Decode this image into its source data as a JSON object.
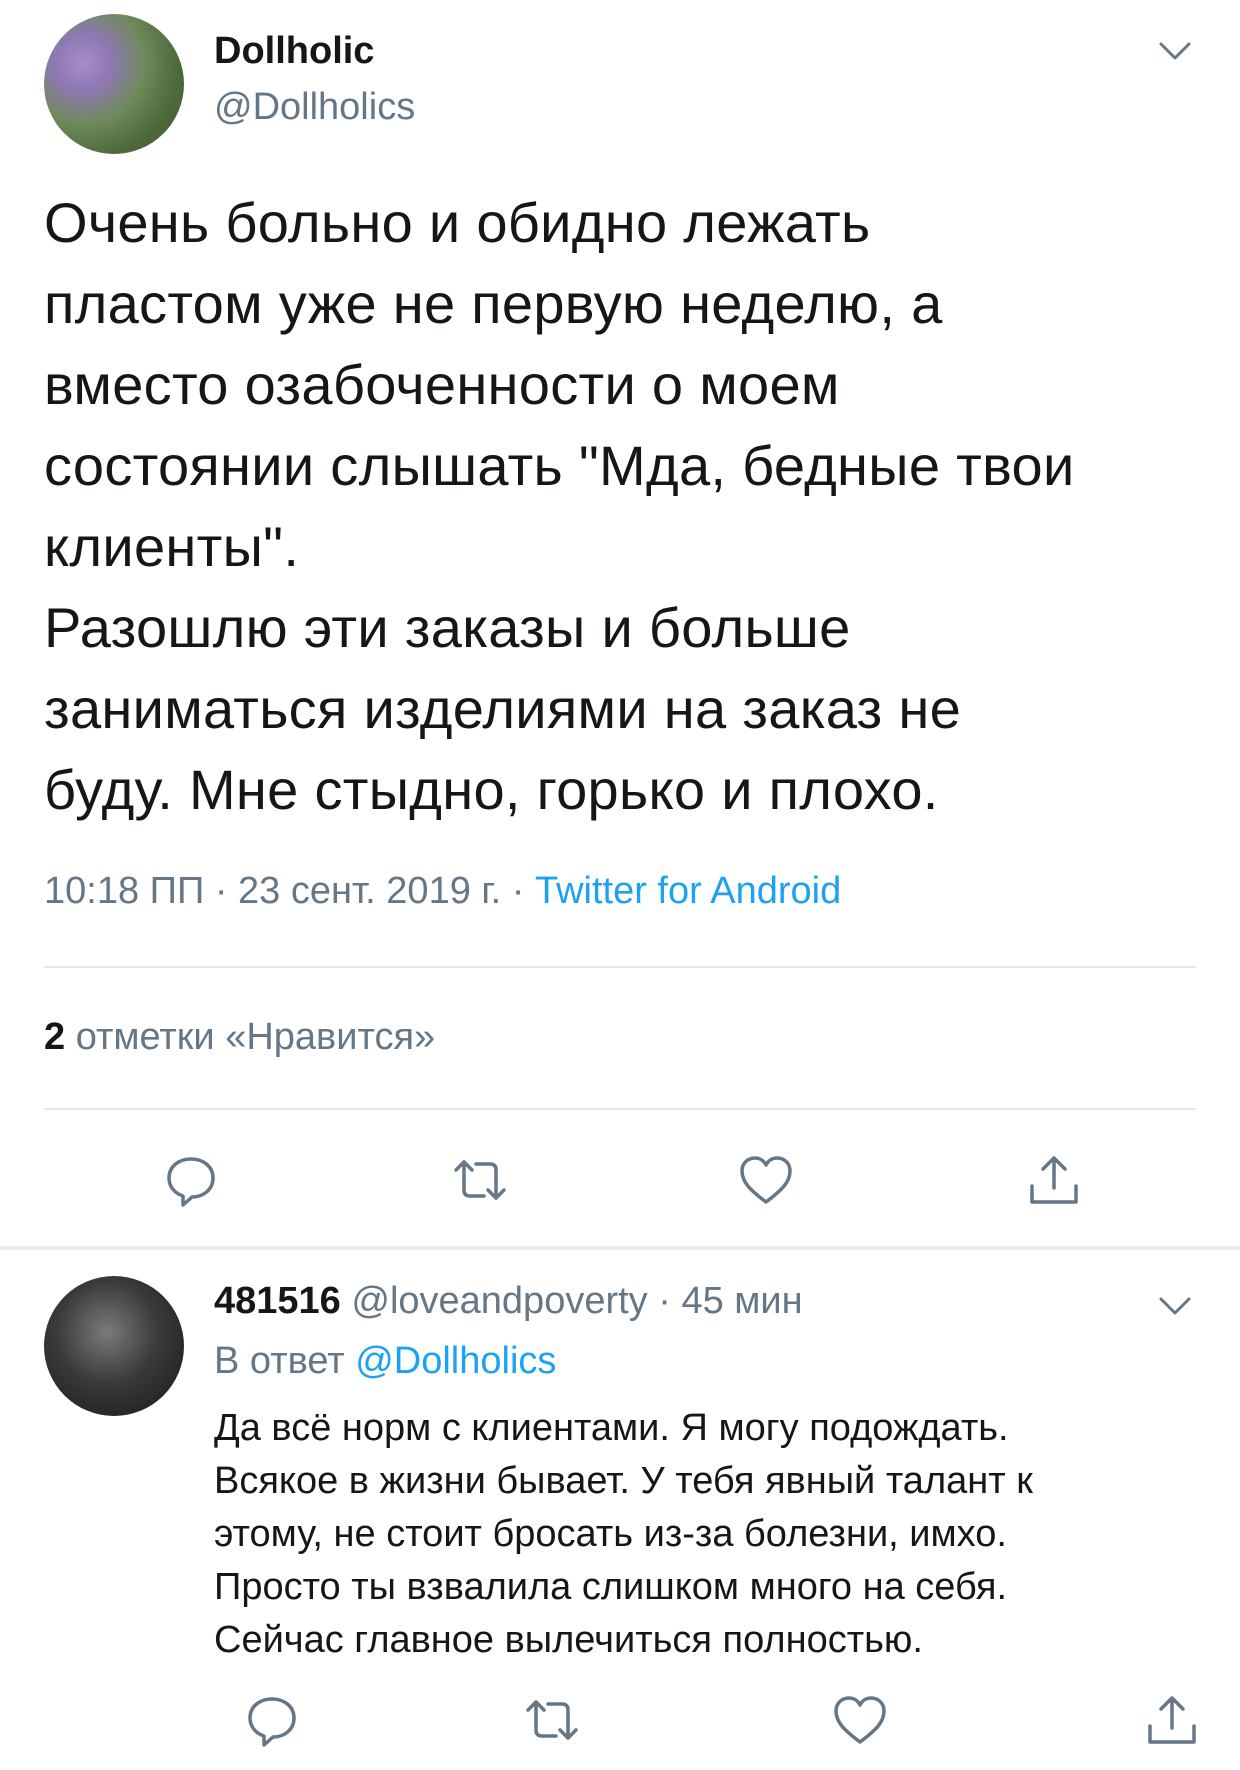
{
  "tweet": {
    "display_name": "Dollholic",
    "handle": "@Dollholics",
    "text": "Очень больно и обидно лежать\nпластом уже не первую неделю, а\nвместо озабоченности о моем\nсостоянии слышать \"Мда, бедные твои\nклиенты\".\nРазошлю эти заказы и больше\nзаниматься изделиями на заказ не\nбуду. Мне стыдно, горько и плохо.",
    "time": "10:18 ПП · 23 сент. 2019 г. · ",
    "source": "Twitter for Android",
    "likes_count": "2",
    "likes_label": " отметки «Нравится»"
  },
  "reply": {
    "display_name": "481516",
    "handle": "@loveandpoverty",
    "time": " · 45 мин",
    "reply_prefix": "В ответ ",
    "reply_mention": "@Dollholics",
    "text": "Да всё норм с клиентами. Я могу подождать.\nВсякое в жизни бывает. У тебя явный талант к\nэтому, не стоит бросать из-за болезни, имхо.\nПросто ты взвалила слишком много на себя.\nСейчас главное вылечиться полностью."
  },
  "icons": [
    "reply-icon",
    "retweet-icon",
    "like-icon",
    "share-icon",
    "chevron-down-icon"
  ],
  "colors": {
    "text": "#14171a",
    "muted": "#657786",
    "accent": "#1da1f2",
    "divider": "#e1e8ed"
  }
}
